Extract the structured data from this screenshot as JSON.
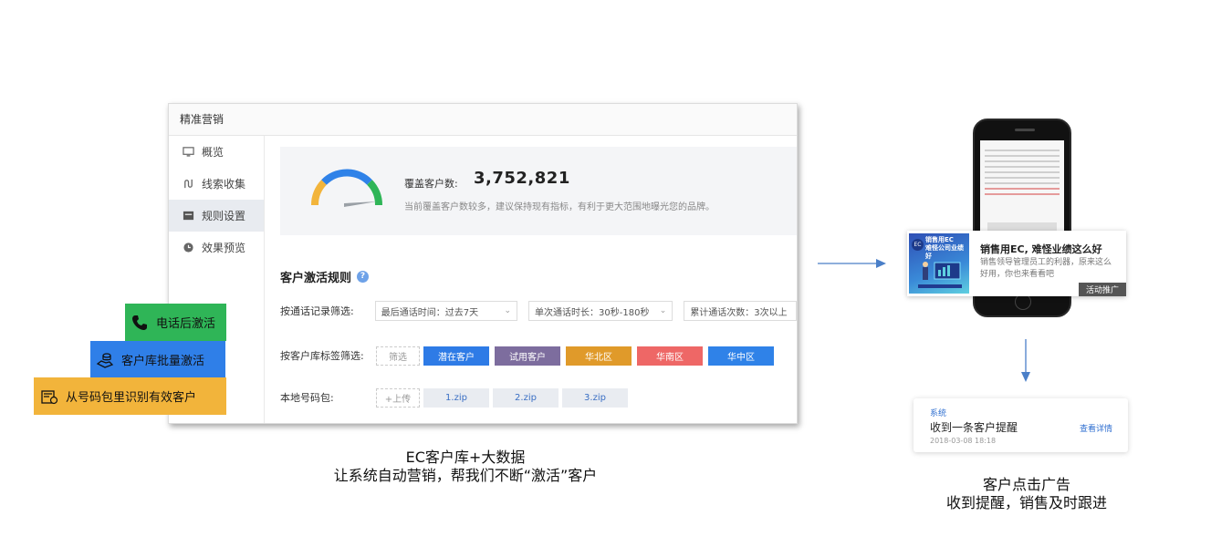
{
  "app": {
    "title": "精准营销",
    "sidebar": [
      {
        "label": "概览",
        "icon": "monitor-icon",
        "active": false
      },
      {
        "label": "线索收集",
        "icon": "funnel-icon",
        "active": false
      },
      {
        "label": "规则设置",
        "icon": "calendar-icon",
        "active": true
      },
      {
        "label": "效果预览",
        "icon": "clock-icon",
        "active": false
      }
    ],
    "coverage": {
      "label": "覆盖客户数:",
      "value": "3,752,821",
      "hint": "当前覆盖客户数较多，建议保持现有指标，有利于更大范围地曝光您的品牌。",
      "gauge_colors": [
        "#f2b43b",
        "#2f82e8",
        "#2fb557"
      ]
    },
    "rules": {
      "title": "客户激活规则",
      "help_glyph": "?",
      "call_filter": {
        "label": "按通话记录筛选:",
        "selects": [
          "最后通话时间：过去7天",
          "单次通话时长：30秒-180秒",
          "累计通话次数：3次以上"
        ]
      },
      "tag_filter": {
        "label": "按客户库标签筛选:",
        "filter_button": "筛选",
        "tags": [
          "潜在客户",
          "试用客户",
          "华北区",
          "华南区",
          "华中区"
        ]
      },
      "local_pack": {
        "label": "本地号码包:",
        "upload_button": "+上传",
        "files": [
          "1.zip",
          "2.zip",
          "3.zip"
        ]
      }
    }
  },
  "callouts": [
    "电话后激活",
    "客户库批量激活",
    "从号码包里识别有效客户"
  ],
  "captions": {
    "left_line1": "EC客户库+大数据",
    "left_line2": "让系统自动营销，帮我们不断“激活”客户",
    "right_line1": "客户点击广告",
    "right_line2": "收到提醒，销售及时跟进"
  },
  "ad": {
    "thumb_ec": "EC",
    "thumb_text_1": "销售用EC",
    "thumb_text_2": "难怪公司业绩好",
    "title": "销售用EC, 难怪业绩这么好",
    "desc": "销售领导管理员工的利器，原来这么好用，你也来看看吧",
    "badge": "活动推广"
  },
  "notification": {
    "source": "系统",
    "message": "收到一条客户提醒",
    "time": "2018-03-08  18:18",
    "link": "查看详情"
  }
}
